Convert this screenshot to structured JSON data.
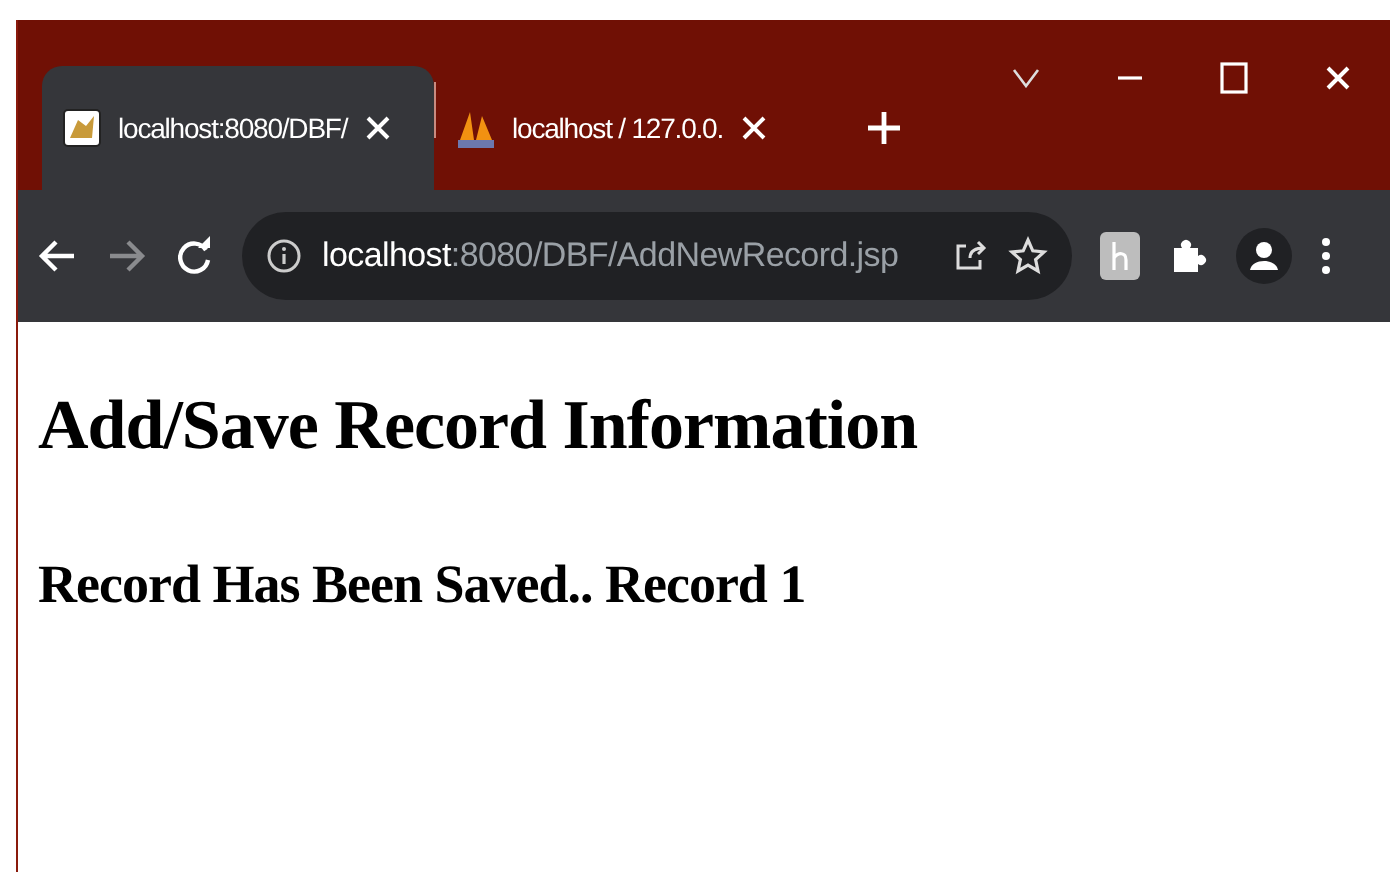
{
  "tabs": [
    {
      "title": "localhost:8080/DBF/",
      "selected": true,
      "kind": "server"
    },
    {
      "title": "localhost / 127.0.0.",
      "selected": false,
      "kind": "database"
    }
  ],
  "address": {
    "host": "localhost",
    "path": ":8080/DBF/AddNewRecord.jsp"
  },
  "page": {
    "heading": "Add/Save Record Information",
    "message": "Record Has Been Saved.. Record 1"
  }
}
